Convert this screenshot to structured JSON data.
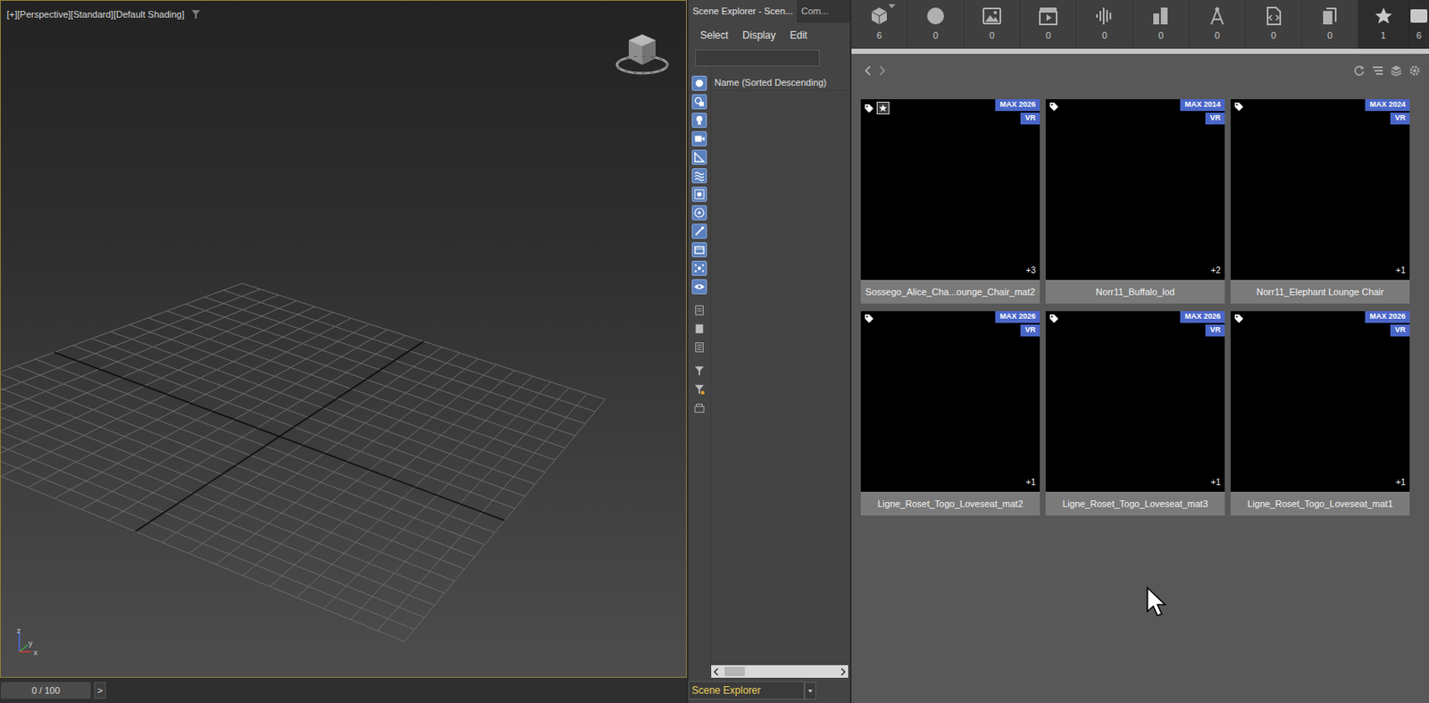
{
  "viewport": {
    "label": "[+][Perspective][Standard][Default Shading]",
    "axes": [
      "z",
      "y",
      "x"
    ]
  },
  "timeline": {
    "reading": "0 / 100",
    "next": ">"
  },
  "scene_explorer": {
    "tabs": [
      {
        "label": "Scene Explorer - Scen...",
        "selected": true
      },
      {
        "label": "Com...",
        "selected": false
      }
    ],
    "menu": [
      "Select",
      "Display",
      "Edit"
    ],
    "filters": [
      {
        "on": true
      },
      {
        "on": true
      },
      {
        "on": true
      },
      {
        "on": true
      },
      {
        "on": true
      },
      {
        "on": true
      },
      {
        "on": true
      },
      {
        "on": true
      },
      {
        "on": true
      },
      {
        "on": true
      },
      {
        "on": true
      },
      {
        "on": true
      },
      {
        "on": false
      },
      {
        "on": false
      },
      {
        "on": false
      },
      {
        "on": false
      },
      {
        "on": false
      },
      {
        "on": false
      }
    ],
    "column": "Name (Sorted Descending)",
    "explorer_name": "Scene Explorer"
  },
  "library": {
    "toolbar": [
      {
        "count": "6",
        "kind": "category"
      },
      {
        "count": "0",
        "kind": "category"
      },
      {
        "count": "0",
        "kind": "category"
      },
      {
        "count": "0",
        "kind": "category"
      },
      {
        "count": "0",
        "kind": "category"
      },
      {
        "count": "0",
        "kind": "category"
      },
      {
        "count": "0",
        "kind": "category"
      },
      {
        "count": "0",
        "kind": "category"
      },
      {
        "count": "0",
        "kind": "category"
      },
      {
        "count": "1",
        "kind": "collection"
      },
      {
        "count": "6",
        "kind": "collection"
      }
    ],
    "items": [
      {
        "name": "Sossego_Alice_Cha...ounge_Chair_mat2",
        "version": "MAX 2026",
        "renderer": "VR",
        "count": "+3",
        "favorite": true
      },
      {
        "name": "Norr11_Buffalo_lod",
        "version": "MAX 2014",
        "renderer": "VR",
        "count": "+2",
        "favorite": false
      },
      {
        "name": "Norr11_Elephant Lounge Chair",
        "version": "MAX 2024",
        "renderer": "VR",
        "count": "+1",
        "favorite": false
      },
      {
        "name": "Ligne_Roset_Togo_Loveseat_mat2",
        "version": "MAX 2026",
        "renderer": "VR",
        "count": "+1",
        "favorite": false
      },
      {
        "name": "Ligne_Roset_Togo_Loveseat_mat3",
        "version": "MAX 2026",
        "renderer": "VR",
        "count": "+1",
        "favorite": false
      },
      {
        "name": "Ligne_Roset_Togo_Loveseat_mat1",
        "version": "MAX 2026",
        "renderer": "VR",
        "count": "+1",
        "favorite": false
      }
    ]
  }
}
